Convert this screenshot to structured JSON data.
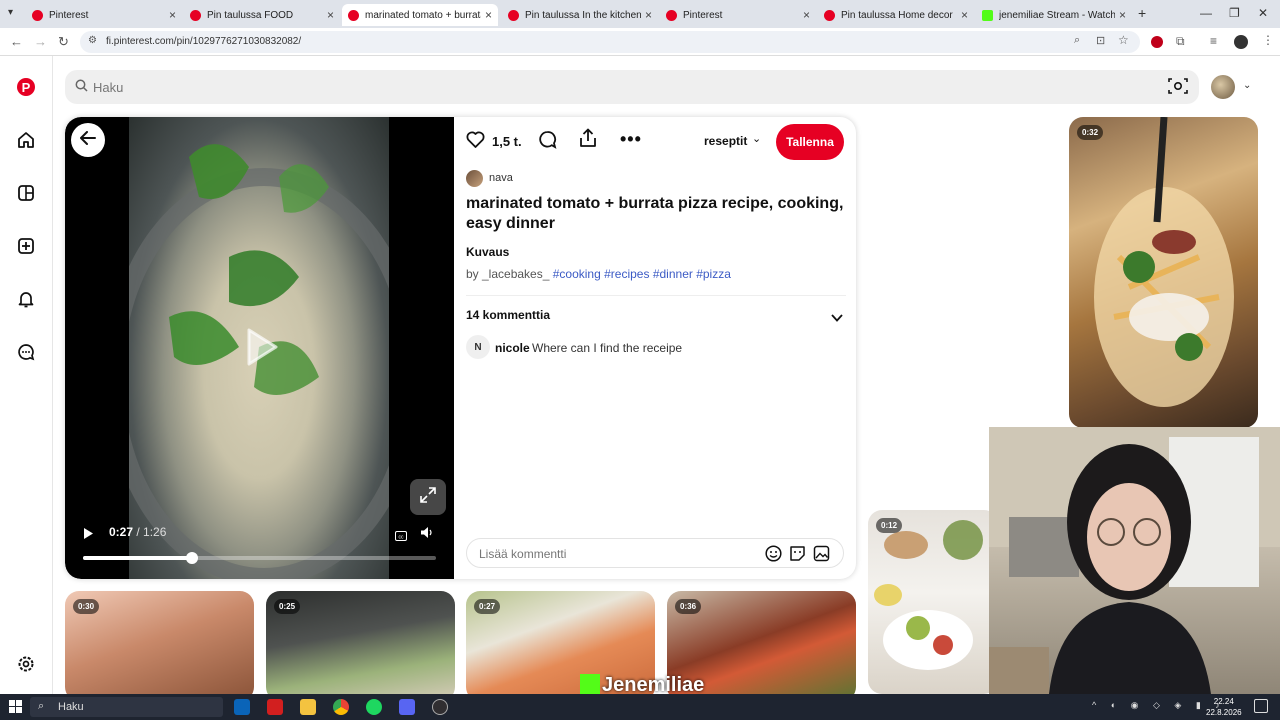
{
  "browser": {
    "tabs": [
      {
        "title": "Pinterest",
        "active": false
      },
      {
        "title": "Pin taulussa FOOD",
        "active": false
      },
      {
        "title": "marinated tomato + burrata pi",
        "active": true
      },
      {
        "title": "Pin taulussa In the kitchen",
        "active": false
      },
      {
        "title": "Pinterest",
        "active": false
      },
      {
        "title": "Pin taulussa Home decor",
        "active": false
      },
      {
        "title": "jenemiliae Stream - Watch Live",
        "active": false
      }
    ],
    "url": "fi.pinterest.com/pin/1029776271030832082/",
    "new_tab": "+"
  },
  "search": {
    "placeholder": "Haku"
  },
  "pin": {
    "like_count": "1,5 t.",
    "board": "reseptit",
    "save_label": "Tallenna",
    "creator": "nava",
    "title": "marinated tomato + burrata pizza recipe, cooking, easy dinner",
    "description_label": "Kuvaus",
    "description_by": "by _lacebakes_",
    "tags": [
      "#cooking",
      "#recipes",
      "#dinner",
      "#pizza"
    ],
    "comments_count": "14 kommenttia",
    "comment": {
      "avatar_letter": "N",
      "author": "nicole",
      "text": "Where can I find the receipe"
    },
    "comment_placeholder": "Lisää kommentti"
  },
  "video": {
    "current_time": "0:27",
    "duration": "1:26",
    "progress_fraction": 0.31
  },
  "related": {
    "badges": [
      "0:32",
      "0:12",
      "0:30",
      "0:25",
      "0:27",
      "0:36"
    ]
  },
  "stream_overlay": {
    "name": "Jenemiliae"
  },
  "taskbar": {
    "search_label": "Haku",
    "time": "22.24",
    "date": "22.8.2026"
  }
}
